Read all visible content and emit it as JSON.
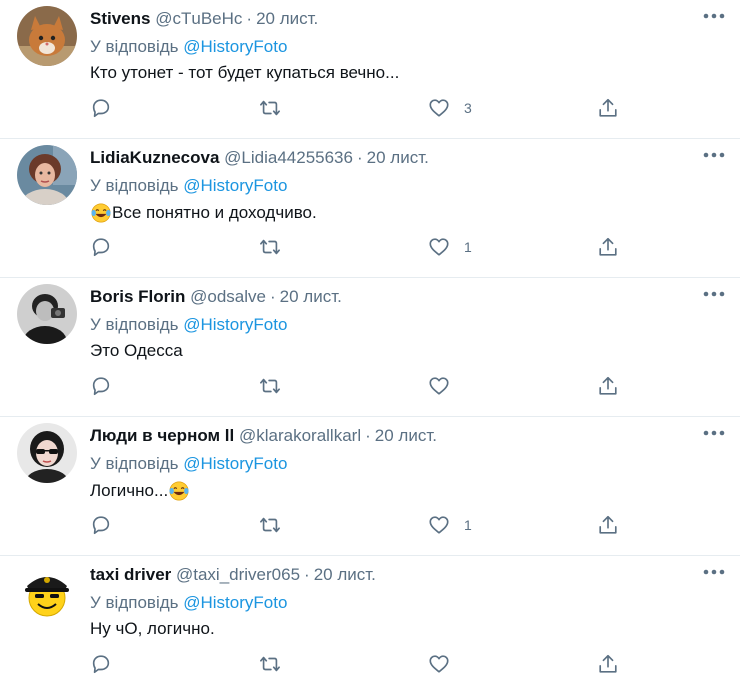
{
  "colors": {
    "text": "#0f1419",
    "muted": "#5b7083",
    "link": "#1b95e0",
    "divider": "#e6ecf0"
  },
  "tweets": [
    {
      "name": "Stivens",
      "handle": "@сТuВеНс",
      "dot": "·",
      "time": "20 лист.",
      "reply_prefix": "У відповідь",
      "mention": "@HistoryFoto",
      "text": "Кто утонет - тот будет купаться вечно...",
      "emoji_before": "",
      "emoji_after": "",
      "likes": "3"
    },
    {
      "name": "LidiaKuznecova",
      "handle": "@Lidia44255636",
      "dot": "·",
      "time": "20 лист.",
      "reply_prefix": "У відповідь",
      "mention": "@HistoryFoto",
      "text": "Все понятно и доходчиво.",
      "emoji_before": "face-with-tears-of-joy",
      "emoji_after": "",
      "likes": "1"
    },
    {
      "name": "Boris Florin",
      "handle": "@odsalve",
      "dot": "·",
      "time": "20 лист.",
      "reply_prefix": "У відповідь",
      "mention": "@HistoryFoto",
      "text": "Это Одесса",
      "emoji_before": "",
      "emoji_after": "",
      "likes": ""
    },
    {
      "name": "Люди в черном ll",
      "handle": "@klarakorallkarl",
      "dot": "·",
      "time": "20 лист.",
      "reply_prefix": "У відповідь",
      "mention": "@HistoryFoto",
      "text": "Логично...",
      "emoji_before": "",
      "emoji_after": "face-with-tears-of-joy",
      "likes": "1"
    },
    {
      "name": "taxi driver",
      "handle": "@taxi_driver065",
      "dot": "·",
      "time": "20 лист.",
      "reply_prefix": "У відповідь",
      "mention": "@HistoryFoto",
      "text": "Ну чО, логично.",
      "emoji_before": "",
      "emoji_after": "",
      "likes": ""
    }
  ],
  "icons": {
    "more": "more-horizontal-icon",
    "reply": "reply-bubble-icon",
    "retweet": "retweet-icon",
    "like": "heart-icon",
    "share": "share-icon"
  }
}
